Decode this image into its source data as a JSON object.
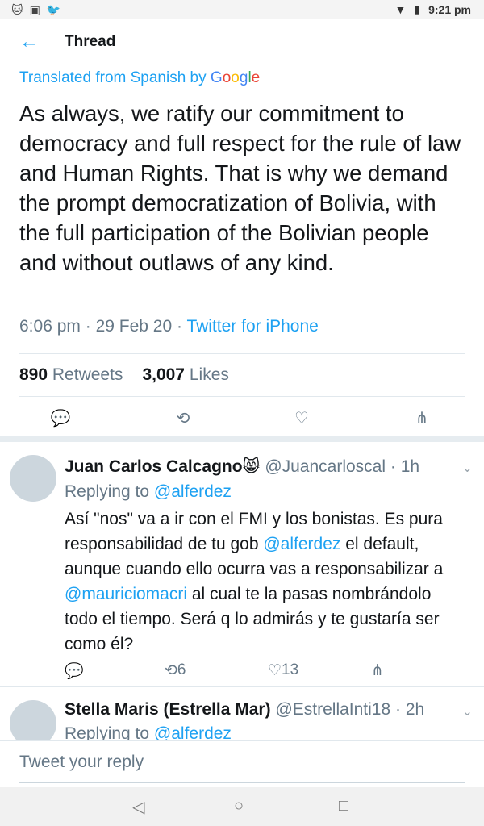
{
  "status": {
    "left_icons": [
      "cat-icon",
      "image-icon",
      "twitter-icon"
    ],
    "time": "9:21 pm"
  },
  "header": {
    "title": "Thread"
  },
  "tweet": {
    "translated_label": "Translated from Spanish by",
    "google": [
      "G",
      "o",
      "o",
      "g",
      "l",
      "e"
    ],
    "text": "As always, we ratify our commitment to democracy and full respect for the rule of law and Human Rights. That is why we demand the prompt democratization of Bolivia, with the full participation of the Bolivian people and without outlaws of any kind.",
    "time": "6:06 pm",
    "date": "29 Feb 20",
    "source": "Twitter for iPhone",
    "retweets": "890",
    "retweets_label": "Retweets",
    "likes": "3,007",
    "likes_label": "Likes"
  },
  "replies": [
    {
      "name": "Juan Carlos Calcagno😸",
      "handle": "@Juancarloscal",
      "age": "· 1h",
      "replying_prefix": "Replying to",
      "replying_to": "@alferdez",
      "text_parts": [
        "Así \"nos\" va a ir con el FMI y los bonistas. Es pura responsabilidad de tu gob ",
        "@alferdez",
        " el default, aunque cuando ello ocurra vas a responsabilizar a ",
        "@mauriciomacri",
        " al cual te la pasas nombrándolo todo el tiempo. Será q lo admirás y te gustaría ser como él?"
      ],
      "retweets": "6",
      "likes": "13"
    },
    {
      "name": "Stella Maris (Estrella Mar)",
      "handle": "@EstrellaInti18",
      "age": "· 2h",
      "replying_prefix": "Replying to",
      "replying_to": "@alferdez"
    }
  ],
  "compose": {
    "placeholder": "Tweet your reply"
  }
}
